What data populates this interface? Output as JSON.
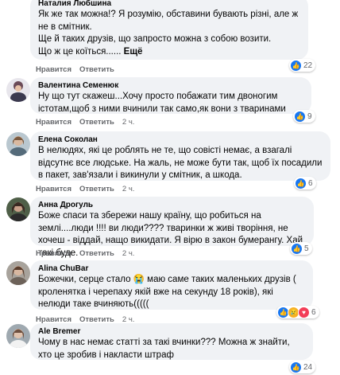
{
  "actions": {
    "like": "Нравится",
    "reply": "Ответить"
  },
  "comments": [
    {
      "name": "Наталия Любшина",
      "text": "Як же так можна!? Я розумію, обставини бувають різні, але ж не в смітник.\nЩе й таких друзів, що запросто можна з собою возити.\nЩо ж це коїться......",
      "more": "Ещё",
      "time": "",
      "reactions": [
        "like"
      ],
      "reaction_count": "22"
    },
    {
      "name": "Валентина Семенюк",
      "text": "Ну що тут скажеш...Хочу просто побажати тим двоногим істотам,щоб з ними вчинили так само,як вони з тваринами",
      "time": "2 ч.",
      "reactions": [
        "like"
      ],
      "reaction_count": "9"
    },
    {
      "name": "Елена Соколан",
      "text": "В нелюдях, які це роблять не те, що совісті немає, а взагалі відсутнє все людське. На жаль, не може бути так, щоб їх посадили в пакет, зав'язали і викинули у смітник, а шкода.",
      "time": "2 ч.",
      "reactions": [
        "like"
      ],
      "reaction_count": "6"
    },
    {
      "name": "Анна Дрогуль",
      "text": "Боже спаси та збережи нашу країну, що робиться на землі....люди !!!! ви люди???? тваринки ж живі творіння, не хочеш - віддай, нащо викидати. Я вірю в закон бумерангу. Хай такі буде.",
      "time": "2 ч.",
      "reactions": [
        "like"
      ],
      "reaction_count": "5"
    },
    {
      "name": "Alina ChuBar",
      "text": "Божечки, серце стало 😭 маю саме таких маленьких друзів ( кроленятка і черепаху якій вже на секунду 18 років), які нелюди таке вчиняють(((((",
      "time": "2 ч.",
      "reactions": [
        "like",
        "sad",
        "love"
      ],
      "reaction_count": "6"
    },
    {
      "name": "Ale Bremer",
      "text": "Чому в нас немає статті за такі вчинки??? Можна ж знайти, хто це зробив і накласти штраф",
      "time": "2 ч.",
      "reactions": [
        "like"
      ],
      "reaction_count": "24"
    }
  ]
}
